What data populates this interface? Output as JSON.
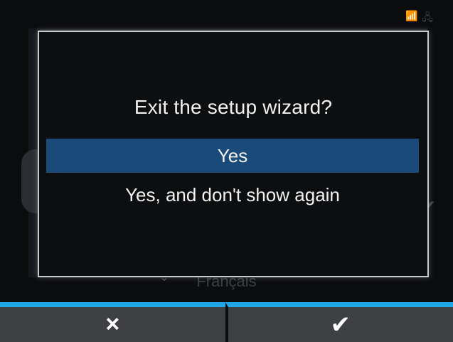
{
  "dialog": {
    "title": "Exit the setup wizard?",
    "options": [
      {
        "label": "Yes",
        "selected": true
      },
      {
        "label": "Yes, and don't show again",
        "selected": false
      }
    ]
  },
  "background": {
    "visible_language": "Français"
  },
  "bottom_bar": {
    "cancel_icon": "×",
    "confirm_icon": "✔"
  },
  "colors": {
    "selected_option": "#1a4a7a",
    "bottom_accent": "#22a7e6",
    "bottom_button_bg": "#3f4044",
    "dialog_border": "#c8cacc"
  }
}
